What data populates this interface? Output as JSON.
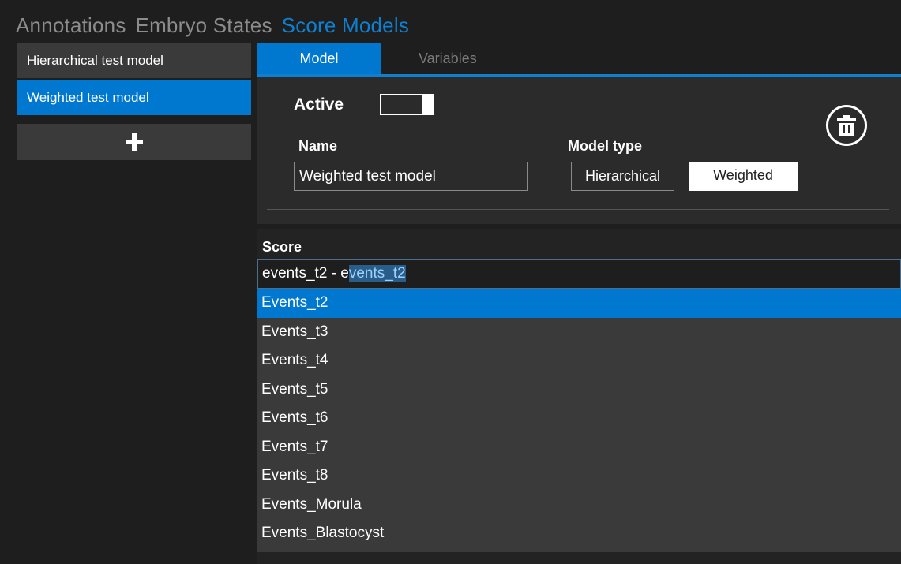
{
  "nav": {
    "items": [
      {
        "label": "Annotations",
        "active": false
      },
      {
        "label": "Embryo States",
        "active": false
      },
      {
        "label": "Score Models",
        "active": true
      }
    ]
  },
  "sidebar": {
    "models": [
      {
        "label": "Hierarchical test model",
        "selected": false
      },
      {
        "label": "Weighted test model",
        "selected": true
      }
    ],
    "add_icon": "plus-icon"
  },
  "tabs": [
    {
      "label": "Model",
      "active": true
    },
    {
      "label": "Variables",
      "active": false
    }
  ],
  "model": {
    "active_label": "Active",
    "active_state": true,
    "name_label": "Name",
    "name_value": "Weighted test model",
    "type_label": "Model type",
    "type_options": [
      {
        "label": "Hierarchical",
        "selected": false
      },
      {
        "label": "Weighted",
        "selected": true
      }
    ],
    "delete_icon": "trash-icon"
  },
  "score": {
    "label": "Score",
    "input_typed": "events_t2 - e",
    "input_autocomplete": "vents_t2",
    "options": [
      {
        "label": "Events_t2",
        "selected": true
      },
      {
        "label": "Events_t3",
        "selected": false
      },
      {
        "label": "Events_t4",
        "selected": false
      },
      {
        "label": "Events_t5",
        "selected": false
      },
      {
        "label": "Events_t6",
        "selected": false
      },
      {
        "label": "Events_t7",
        "selected": false
      },
      {
        "label": "Events_t8",
        "selected": false
      },
      {
        "label": "Events_Morula",
        "selected": false
      },
      {
        "label": "Events_Blastocyst",
        "selected": false
      }
    ]
  },
  "colors": {
    "accent": "#0078d0",
    "nav_active": "#0f7fd0",
    "background": "#1e1e1e",
    "panel": "#2b2b2b",
    "list_item": "#3a3a3a"
  }
}
